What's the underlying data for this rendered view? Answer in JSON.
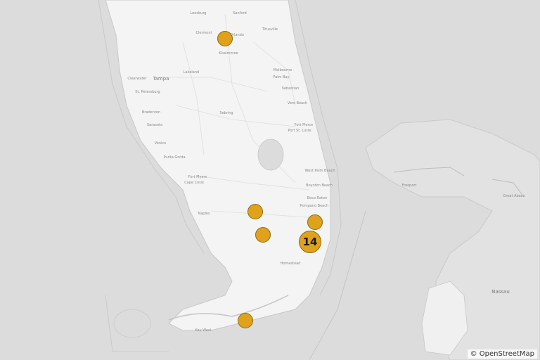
{
  "attribution": "© OpenStreetMap",
  "colors": {
    "marker_fill": "#e0a21a",
    "marker_stroke": "#8a6a1a",
    "land": "#f4f4f4",
    "water": "#dcdcdc"
  },
  "markers": [
    {
      "id": "orlando",
      "kind": "single",
      "count": ""
    },
    {
      "id": "naples-area",
      "kind": "single",
      "count": ""
    },
    {
      "id": "everglades-west",
      "kind": "single",
      "count": ""
    },
    {
      "id": "fort-lauderdale",
      "kind": "single",
      "count": ""
    },
    {
      "id": "miami",
      "kind": "cluster",
      "count": "14"
    },
    {
      "id": "keys",
      "kind": "single",
      "count": ""
    }
  ],
  "labels": [
    "Leesburg",
    "Sanford",
    "Titusville",
    "Clermont",
    "Orlando",
    "Kissimmee",
    "Clearwater",
    "Tampa",
    "St. Petersburg",
    "Lakeland",
    "Melbourne",
    "Palm Bay",
    "Bradenton",
    "Sebastian",
    "Sarasota",
    "Sebring",
    "Vero Beach",
    "Fort Pierce",
    "Port St. Lucie",
    "Venice",
    "Punta Gorda",
    "West Palm Beach",
    "Fort Myers",
    "Cape Coral",
    "Boynton Beach",
    "Boca Raton",
    "Pompano Beach",
    "Naples",
    "Homestead",
    "Key West",
    "Freeport",
    "Great Abaco",
    "Nassau"
  ]
}
